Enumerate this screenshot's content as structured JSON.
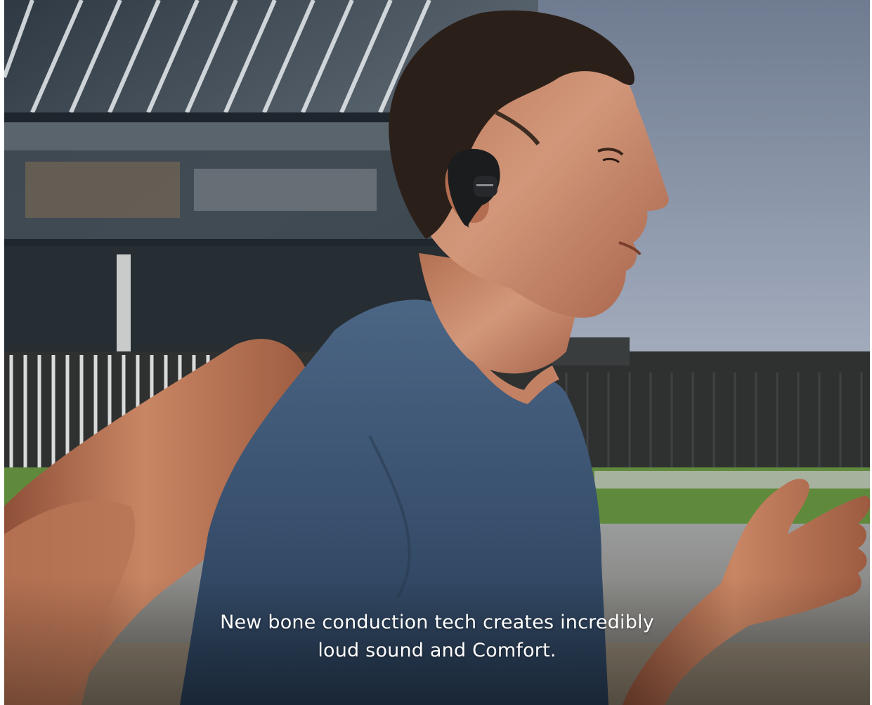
{
  "caption": {
    "line1": "New bone conduction tech creates incredibly",
    "line2": "loud sound and Comfort."
  },
  "colors": {
    "sky": "#8f99ac",
    "building": "#3a4550",
    "fence": "#2e302f",
    "grass": "#5f8a3c",
    "tank_top": "#3d5470",
    "skin": "#c98866",
    "hair": "#2b2019",
    "earbud": "#1b1c1e"
  }
}
